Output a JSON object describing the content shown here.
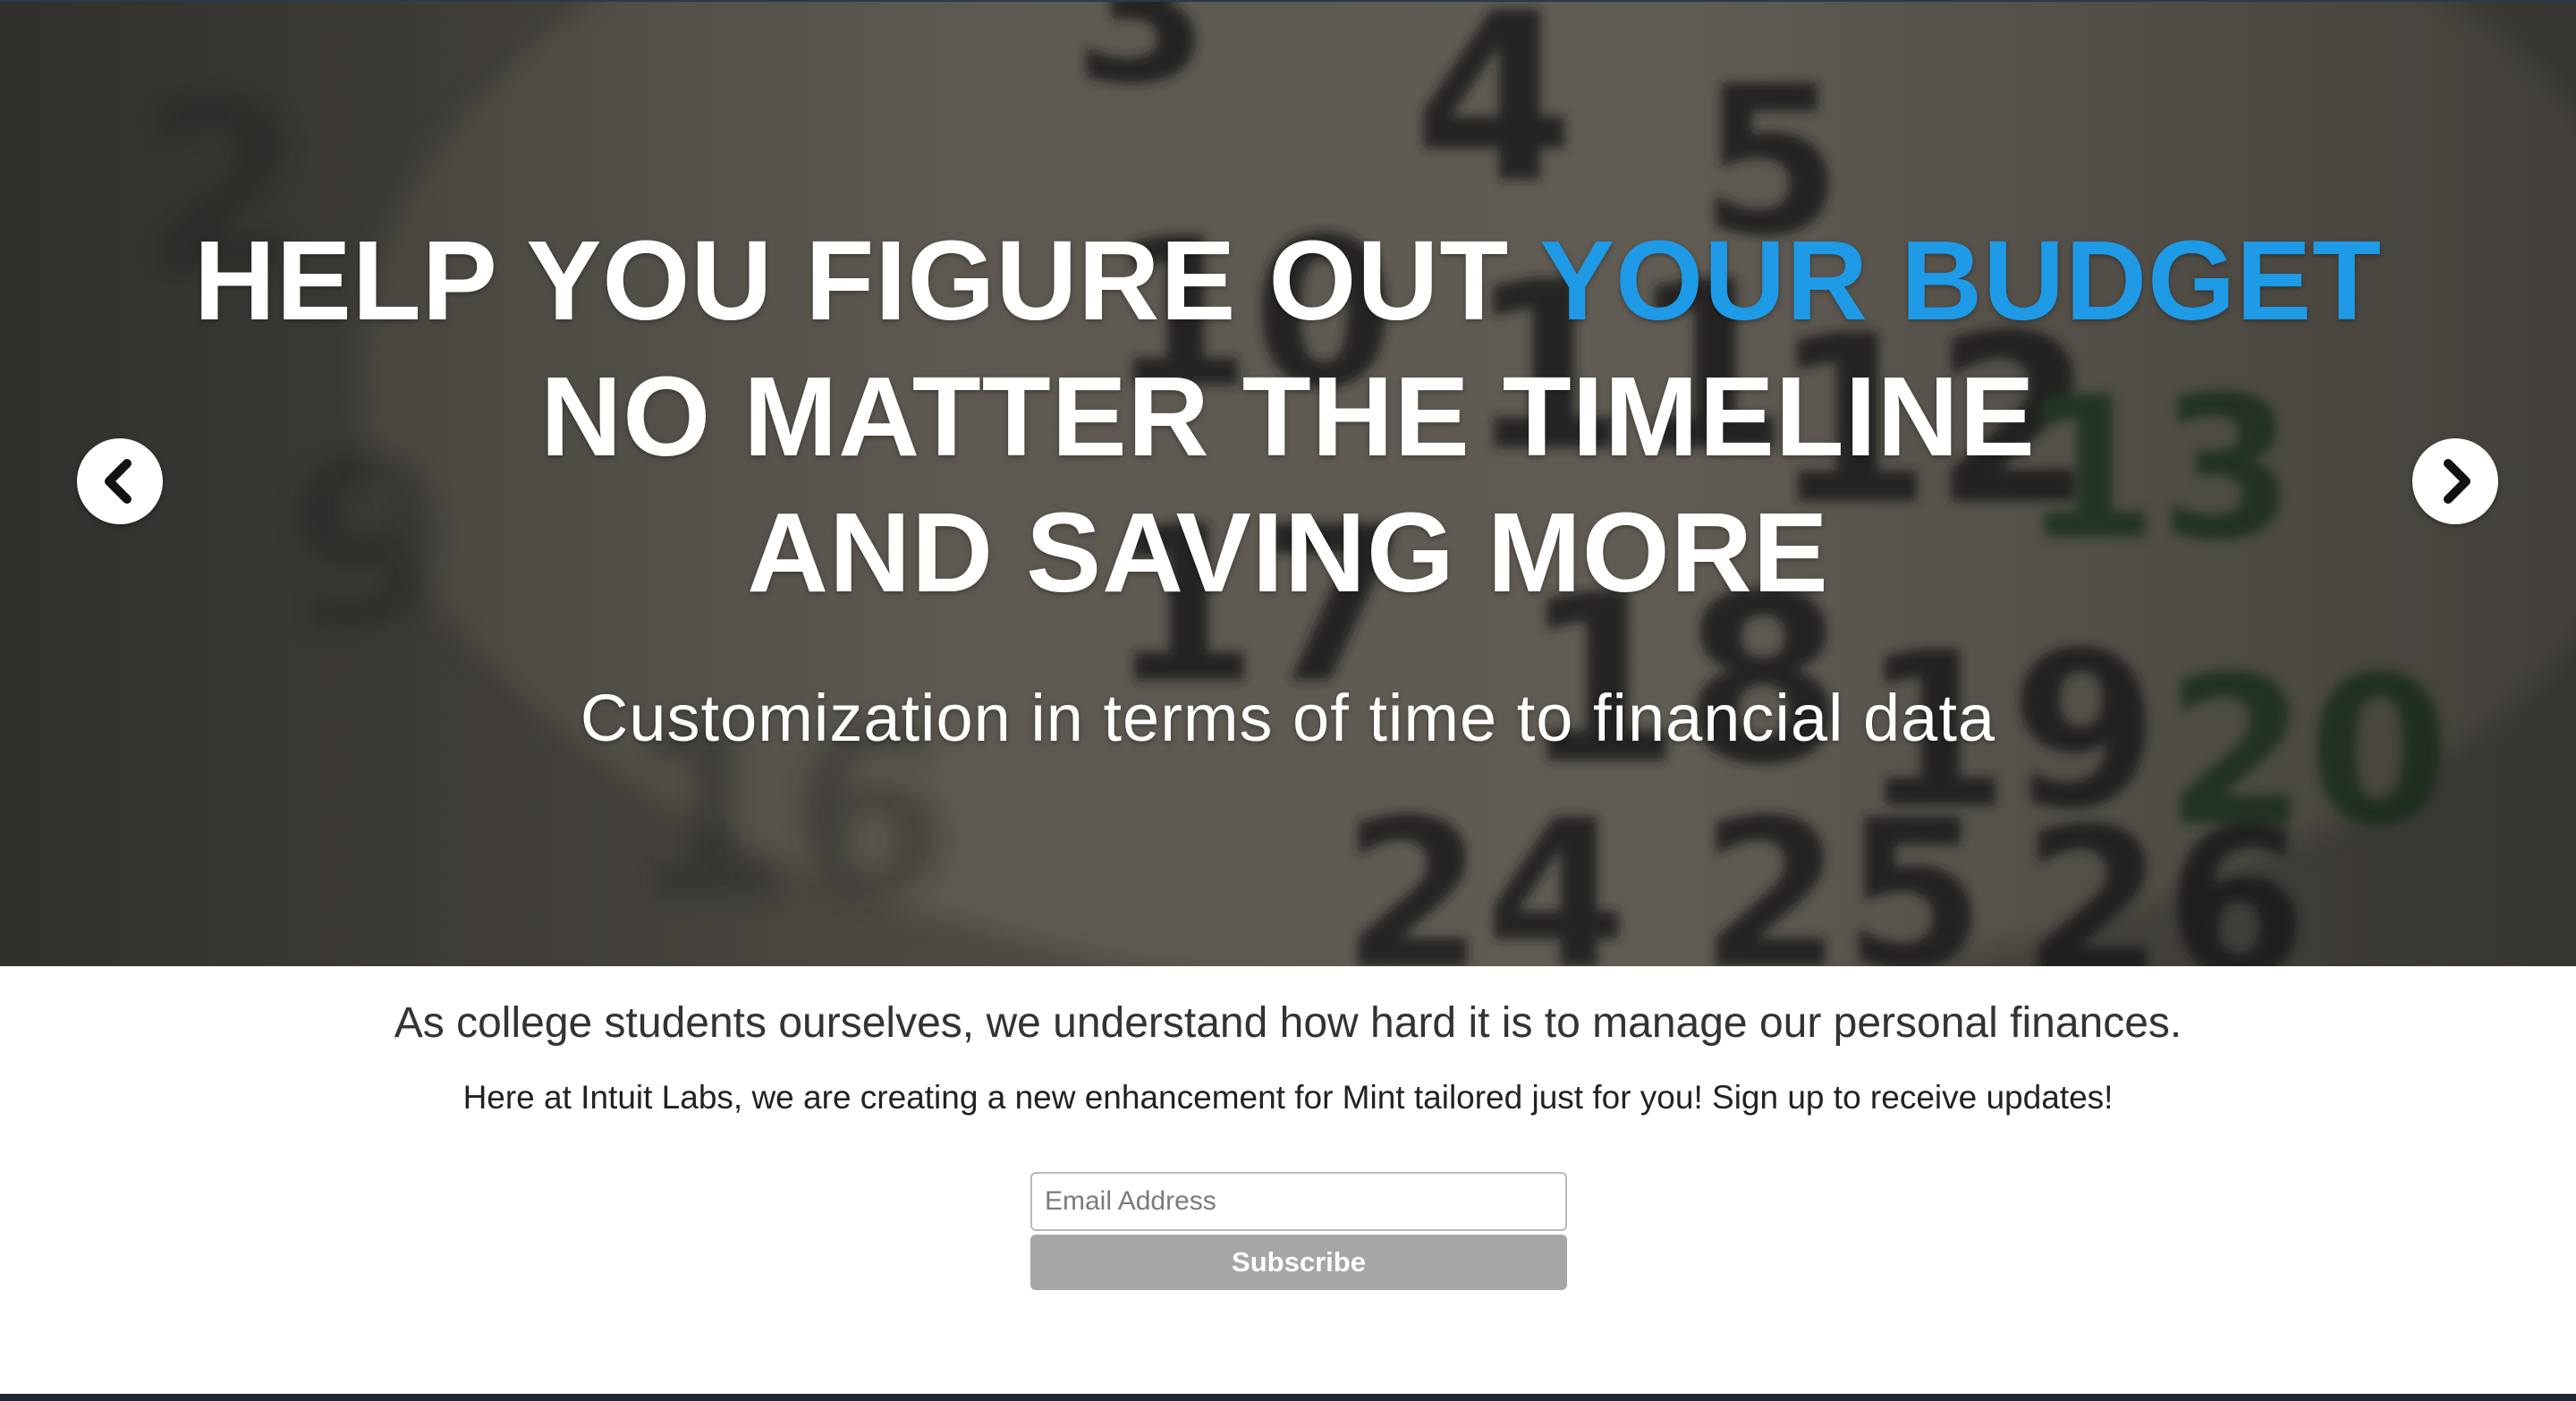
{
  "hero": {
    "headline": {
      "line1_white": "HELP YOU FIGURE OUT ",
      "line1_accent": "YOUR BUDGET",
      "line2": "NO MATTER THE TIMELINE",
      "line3": "AND SAVING MORE"
    },
    "subheadline": "Customization in terms of time to financial data",
    "prev_icon": "chevron-left-circle-icon",
    "next_icon": "chevron-right-circle-icon",
    "background": {
      "description_icon": "calendar-photo",
      "calendar_numbers": [
        "3",
        "4",
        "5",
        "10",
        "11",
        "12",
        "13",
        "17",
        "18",
        "19",
        "20",
        "24",
        "25",
        "26"
      ]
    }
  },
  "signup": {
    "intro": "As college students ourselves, we understand how hard it is to manage our personal finances.",
    "tagline": "Here at Intuit Labs, we are creating a new enhancement for Mint tailored just for you! Sign up to receive updates!",
    "email_placeholder": "Email Address",
    "email_value": "",
    "subscribe_label": "Subscribe"
  },
  "colors": {
    "accent": "#1e9ae6",
    "button": "#a6a6a6",
    "footer": "#1d2a36"
  }
}
